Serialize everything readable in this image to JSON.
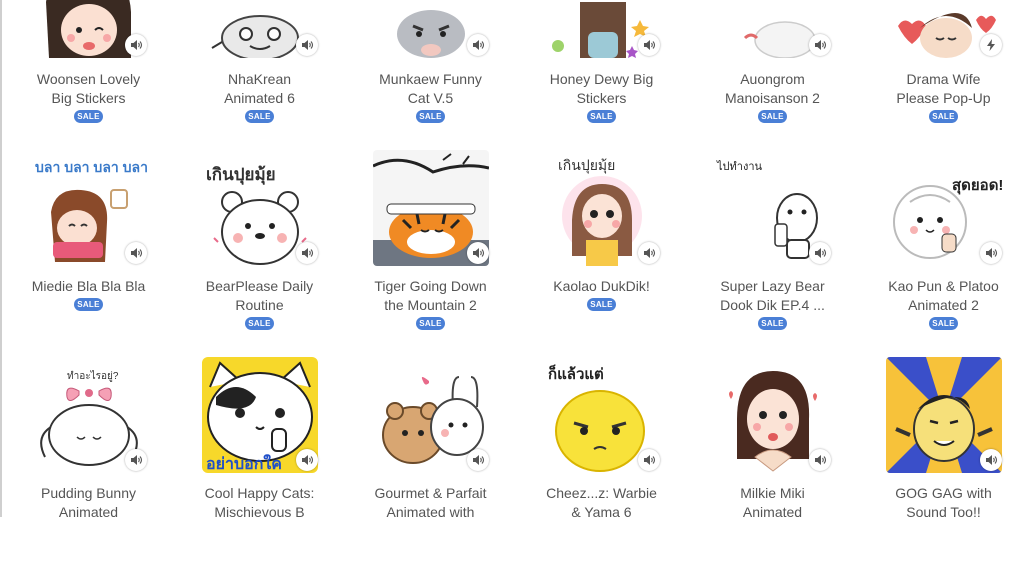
{
  "colors": {
    "sale_badge": "#4a7fd6",
    "title_text": "#555555"
  },
  "icons": {
    "sound": "speaker-icon",
    "animated": "lightning-icon"
  },
  "rows": [
    {
      "items": [
        {
          "title": "Woonsen Lovely\nBig Stickers",
          "badge": "SALE",
          "icon": "speaker-icon"
        },
        {
          "title": "NhaKrean\nAnimated 6",
          "badge": "SALE",
          "icon": "speaker-icon"
        },
        {
          "title": "Munkaew Funny\nCat V.5",
          "badge": "SALE",
          "icon": "speaker-icon"
        },
        {
          "title": "Honey Dewy Big\nStickers",
          "badge": "SALE",
          "icon": "speaker-icon"
        },
        {
          "title": "Auongrom\nManoisanson 2",
          "badge": "SALE",
          "icon": "speaker-icon"
        },
        {
          "title": "Drama Wife\nPlease Pop-Up",
          "badge": "SALE",
          "icon": "lightning-icon"
        }
      ]
    },
    {
      "items": [
        {
          "title": "Miedie Bla Bla Bla",
          "badge": "SALE",
          "icon": "speaker-icon",
          "art_text": "บลา บลา บลา บลา"
        },
        {
          "title": "BearPlease Daily\nRoutine",
          "badge": "SALE",
          "icon": "speaker-icon",
          "art_text": "เกินปุยมุ้ย"
        },
        {
          "title": "Tiger Going Down\nthe Mountain 2",
          "badge": "SALE",
          "icon": "speaker-icon"
        },
        {
          "title": "Kaolao DukDik!",
          "badge": "SALE",
          "icon": "speaker-icon",
          "art_text": "เกินปุยมุ้ย"
        },
        {
          "title": "Super Lazy Bear\nDook Dik EP.4 ...",
          "badge": "SALE",
          "icon": "speaker-icon",
          "art_text": "ไปทำงาน"
        },
        {
          "title": "Kao Pun & Platoo\nAnimated 2",
          "badge": "SALE",
          "icon": "speaker-icon",
          "art_text": "สุดยอด!"
        }
      ]
    },
    {
      "items": [
        {
          "title": "Pudding Bunny\nAnimated",
          "icon": "speaker-icon",
          "art_text": "ทำอะไรอยู่?"
        },
        {
          "title": "Cool Happy Cats:\nMischievous B",
          "icon": "speaker-icon",
          "art_text": "อย่าบอกใค"
        },
        {
          "title": "Gourmet & Parfait\nAnimated with",
          "icon": "speaker-icon"
        },
        {
          "title": "Cheez...z: Warbie\n& Yama 6",
          "icon": "speaker-icon",
          "art_text": "ก็แล้วแต่"
        },
        {
          "title": "Milkie Miki\nAnimated",
          "icon": "speaker-icon"
        },
        {
          "title": "GOG GAG with\nSound Too!!",
          "icon": "speaker-icon"
        }
      ]
    }
  ]
}
